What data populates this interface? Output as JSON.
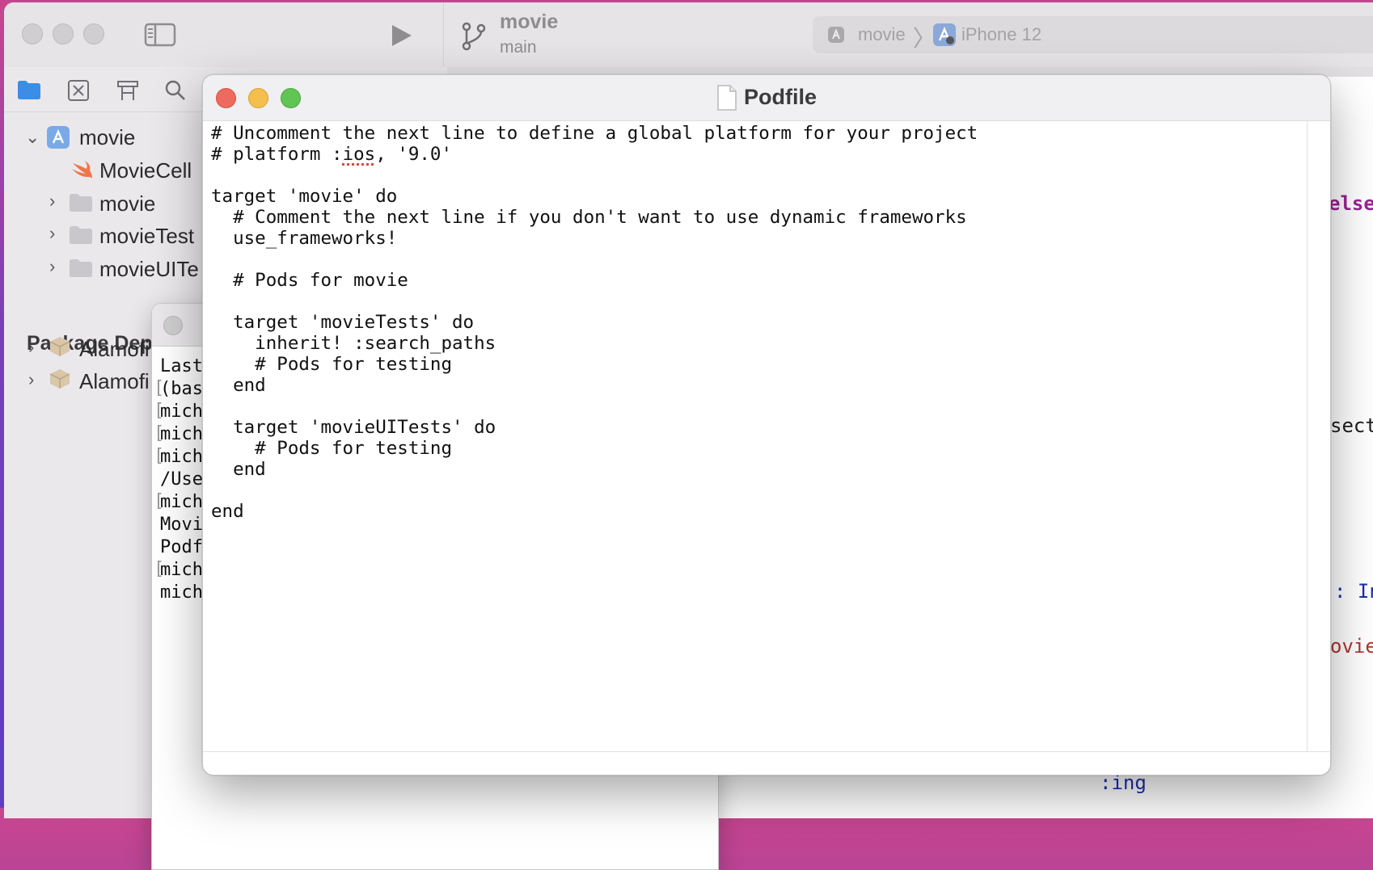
{
  "xcode": {
    "scheme_name": "movie",
    "scheme_branch": "main",
    "selector_project": "movie",
    "selector_chevron": "〉",
    "selector_device": "iPhone 12",
    "navigator_tabs": [
      "folder-icon",
      "source-control-icon",
      "symbol-icon",
      "find-icon"
    ],
    "tree": {
      "project": "movie",
      "file_moviecell": "MovieCell",
      "group_movie": "movie",
      "group_tests": "movieTest",
      "group_uitests": "movieUITe",
      "packages_header": "Package Dep",
      "package_1": "Alamofi",
      "package_2": "Alamofi"
    },
    "code_fragments": {
      "else": "else",
      "sect": "sect",
      "colon_in": ": In",
      "ovie": "ovie",
      "ing": ":ing"
    }
  },
  "terminal": {
    "lines": [
      "Last",
      "(bas",
      "mich",
      "mich",
      "mich",
      "/Use",
      "mich",
      "Movi",
      "Podf",
      "mich",
      "mich"
    ]
  },
  "textedit": {
    "title": "Podfile",
    "code": {
      "line1": "# Uncomment the next line to define a global platform for your project",
      "line2_prefix": "# platform :",
      "line2_misspelled": "ios",
      "line2_suffix": ", '9.0'",
      "rest": "\ntarget 'movie' do\n  # Comment the next line if you don't want to use dynamic frameworks\n  use_frameworks!\n\n  # Pods for movie\n\n  target 'movieTests' do\n    inherit! :search_paths\n    # Pods for testing\n  end\n\n  target 'movieUITests' do\n    # Pods for testing\n  end\n\nend"
    }
  },
  "colors": {
    "close": "#ed6a5e",
    "minimize": "#f5bf4f",
    "zoom": "#61c554",
    "accent": "#2f7fd8"
  }
}
